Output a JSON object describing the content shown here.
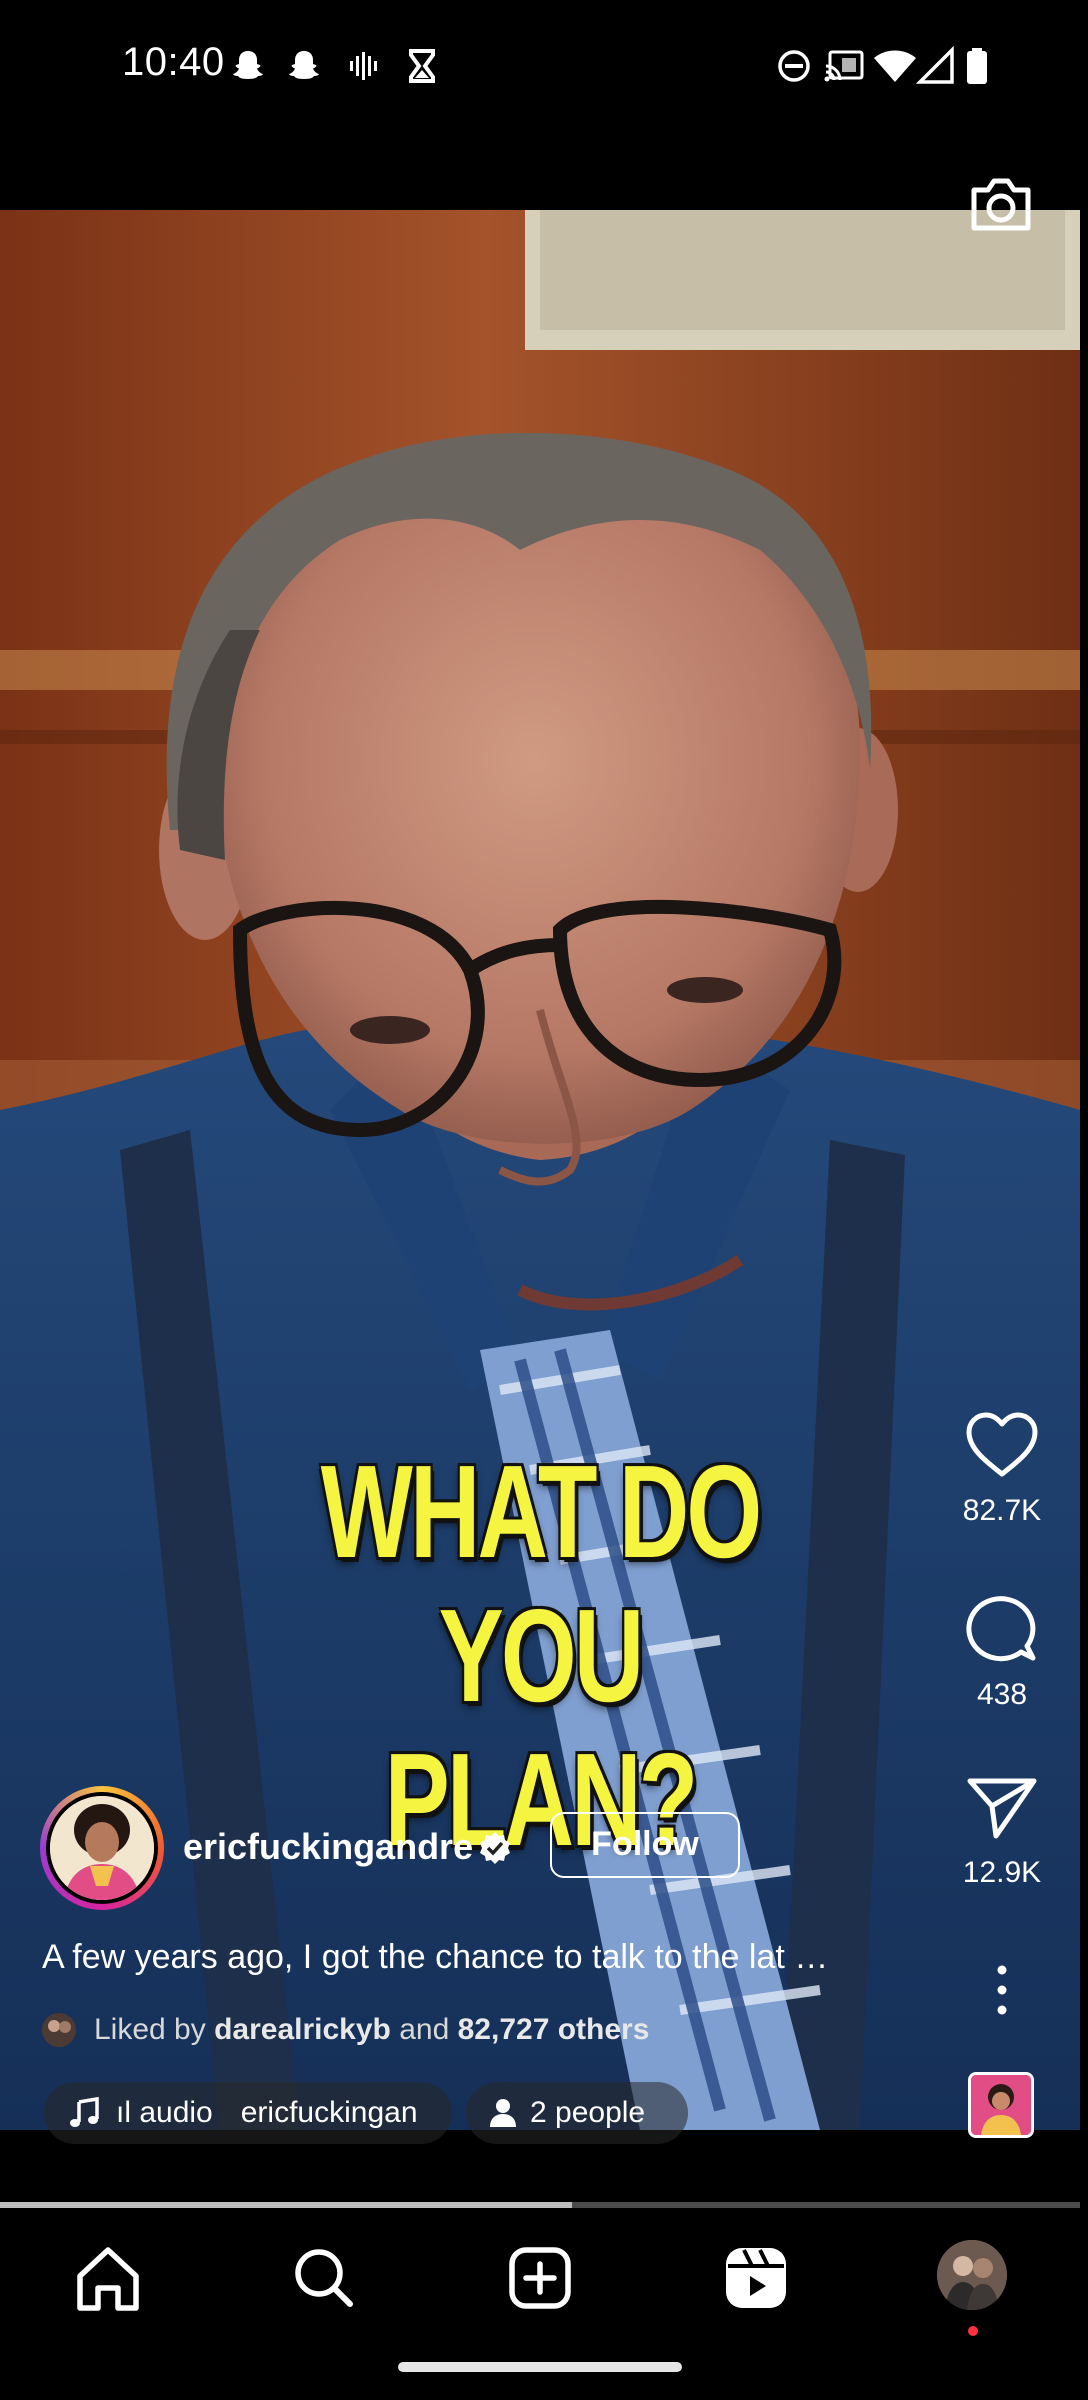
{
  "status_bar": {
    "time": "10:40",
    "left_icons": [
      "snapchat-icon",
      "snapchat-icon",
      "voicemail-icon",
      "hourglass-icon"
    ],
    "right_icons": [
      "do-not-disturb-icon",
      "cast-icon",
      "wifi-icon",
      "signal-icon",
      "battery-icon"
    ]
  },
  "video": {
    "caption_line1": "WHAT DO YOU",
    "caption_line2": "PLAN?",
    "caption_color": "#f4f441"
  },
  "actions": {
    "like_count": "82.7K",
    "comment_count": "438",
    "share_count": "12.9K"
  },
  "author": {
    "username": "ericfuckingandre",
    "verified": true,
    "follow_label": "Follow"
  },
  "post": {
    "caption": "A few years ago, I got the chance to talk to the lat …",
    "liked_prefix": "Liked by",
    "liked_user": "darealrickyb",
    "liked_and": "and",
    "liked_others": "82,727 others"
  },
  "chips": {
    "audio_label": "ıl audio",
    "audio_user": "ericfuckingan",
    "people_label": "2 people"
  },
  "progress": {
    "fraction": 0.53
  },
  "nav": {
    "items": [
      "home-icon",
      "search-icon",
      "create-icon",
      "reels-icon",
      "profile-avatar"
    ],
    "accent": "#ff3040"
  }
}
